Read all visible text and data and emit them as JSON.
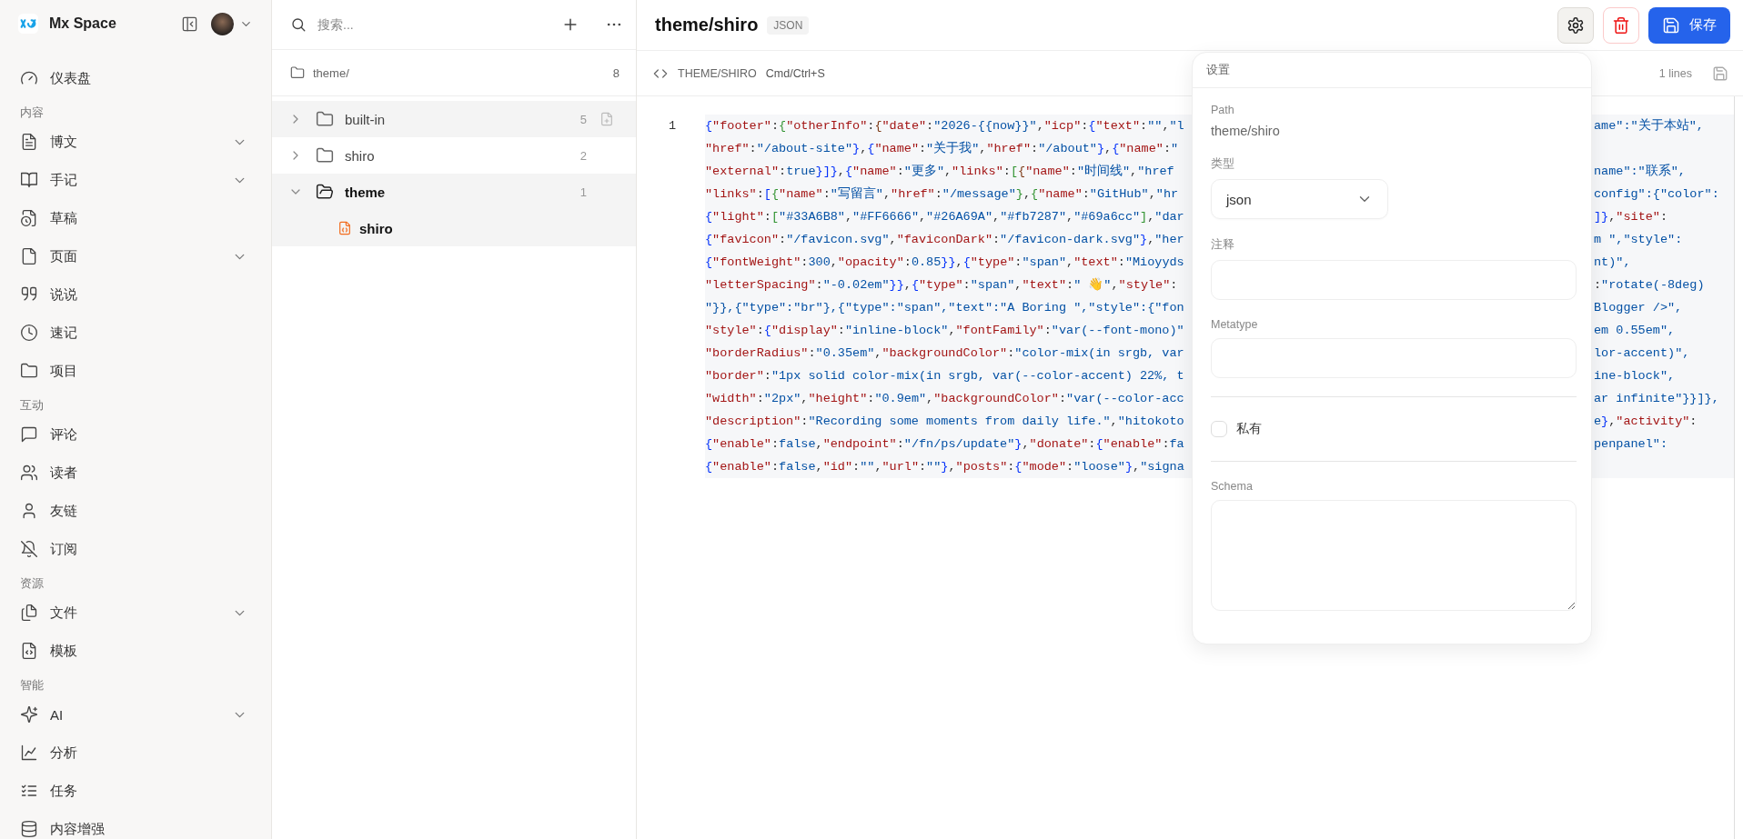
{
  "sidebar": {
    "brand": "Mx Space",
    "nav": [
      {
        "kind": "item",
        "label": "仪表盘",
        "has_submenu": false
      },
      {
        "kind": "heading",
        "label": "内容"
      },
      {
        "kind": "item",
        "label": "博文",
        "has_submenu": true
      },
      {
        "kind": "item",
        "label": "手记",
        "has_submenu": true
      },
      {
        "kind": "item",
        "label": "草稿",
        "has_submenu": false
      },
      {
        "kind": "item",
        "label": "页面",
        "has_submenu": true
      },
      {
        "kind": "item",
        "label": "说说",
        "has_submenu": false
      },
      {
        "kind": "item",
        "label": "速记",
        "has_submenu": false
      },
      {
        "kind": "item",
        "label": "项目",
        "has_submenu": false
      },
      {
        "kind": "heading",
        "label": "互动"
      },
      {
        "kind": "item",
        "label": "评论",
        "has_submenu": false
      },
      {
        "kind": "item",
        "label": "读者",
        "has_submenu": false
      },
      {
        "kind": "item",
        "label": "友链",
        "has_submenu": false
      },
      {
        "kind": "item",
        "label": "订阅",
        "has_submenu": false
      },
      {
        "kind": "heading",
        "label": "资源"
      },
      {
        "kind": "item",
        "label": "文件",
        "has_submenu": true
      },
      {
        "kind": "item",
        "label": "模板",
        "has_submenu": false
      },
      {
        "kind": "heading",
        "label": "智能"
      },
      {
        "kind": "item",
        "label": "AI",
        "has_submenu": true
      },
      {
        "kind": "item",
        "label": "分析",
        "has_submenu": false
      },
      {
        "kind": "item",
        "label": "任务",
        "has_submenu": false
      },
      {
        "kind": "item",
        "label": "内容增强",
        "has_submenu": false
      }
    ]
  },
  "file_panel": {
    "search": {
      "placeholder": "搜索..."
    },
    "root": {
      "label": "theme/",
      "count": "8"
    },
    "tree": [
      {
        "kind": "folder",
        "name": "built-in",
        "count": "5",
        "expanded": false,
        "hovered": true
      },
      {
        "kind": "folder",
        "name": "shiro",
        "count": "2",
        "expanded": false,
        "hovered": false
      },
      {
        "kind": "folder",
        "name": "theme",
        "count": "1",
        "expanded": true,
        "hovered": false,
        "children": [
          {
            "kind": "file",
            "name": "shiro",
            "selected": true
          }
        ]
      }
    ]
  },
  "editor": {
    "title": "theme/shiro",
    "badge": "JSON",
    "save_label": "保存",
    "toolbar": {
      "path": "THEME/SHIRO",
      "shortcut": "Cmd/Ctrl+S",
      "line_count": "1 lines"
    },
    "line_number": "1",
    "lines": [
      {
        "left": "{\"footer\":{\"otherInfo\":{\"date\":\"2026-{{now}}\",\"icp\":{\"text\":\"\",\"l",
        "right": "ame\":\"关于本站\","
      },
      {
        "left": "\"href\":\"/about-site\"},{\"name\":\"关于我\",\"href\":\"/about\"},{\"name\":\""
      },
      {
        "left": "\"external\":true}]},{\"name\":\"更多\",\"links\":[{\"name\":\"时间线\",\"href",
        "right": "name\":\"联系\","
      },
      {
        "left": "\"links\":[{\"name\":\"写留言\",\"href\":\"/message\"},{\"name\":\"GitHub\",\"hr",
        "right": "config\":{\"color\":"
      },
      {
        "left": "{\"light\":[\"#33A6B8\",\"#FF6666\",\"#26A69A\",\"#fb7287\",\"#69a6cc\"],\"dar",
        "right": "]},\"site\":"
      },
      {
        "left": "{\"favicon\":\"/favicon.svg\",\"faviconDark\":\"/favicon-dark.svg\"},\"her",
        "right": "m \",\"style\":"
      },
      {
        "left": "{\"fontWeight\":300,\"opacity\":0.85}},{\"type\":\"span\",\"text\":\"Mioyyds",
        "right": "nt)\","
      },
      {
        "left": "\"letterSpacing\":\"-0.02em\"}},{\"type\":\"span\",\"text\":\" 👋\",\"style\":",
        "right": ":\"rotate(-8deg)"
      },
      {
        "left": "\"}},{\"type\":\"br\"},{\"type\":\"span\",\"text\":\"A Boring \",\"style\":{\"fon",
        "right": "Blogger />\","
      },
      {
        "left": "\"style\":{\"display\":\"inline-block\",\"fontFamily\":\"var(--font-mono)\"",
        "right": "em 0.55em\","
      },
      {
        "left": "\"borderRadius\":\"0.35em\",\"backgroundColor\":\"color-mix(in srgb, var",
        "right": "lor-accent)\","
      },
      {
        "left": "\"border\":\"1px solid color-mix(in srgb, var(--color-accent) 22%, t",
        "right": "ine-block\","
      },
      {
        "left": "\"width\":\"2px\",\"height\":\"0.9em\",\"backgroundColor\":\"var(--color-acc",
        "right": "ar infinite\"}}]},"
      },
      {
        "left": "\"description\":\"Recording some moments from daily life.\",\"hitokoto",
        "right": "e},\"activity\":"
      },
      {
        "left": "{\"enable\":false,\"endpoint\":\"/fn/ps/update\"},\"donate\":{\"enable\":fa",
        "right": "penpanel\":"
      },
      {
        "left": "{\"enable\":false,\"id\":\"\",\"url\":\"\"},\"posts\":{\"mode\":\"loose\"},\"signa"
      }
    ]
  },
  "settings": {
    "title": "设置",
    "path_label": "Path",
    "path_value": "theme/shiro",
    "type_label": "类型",
    "type_value": "json",
    "note_label": "注释",
    "metatype_label": "Metatype",
    "private": {
      "label": "私有",
      "checked": false
    },
    "schema_label": "Schema"
  }
}
